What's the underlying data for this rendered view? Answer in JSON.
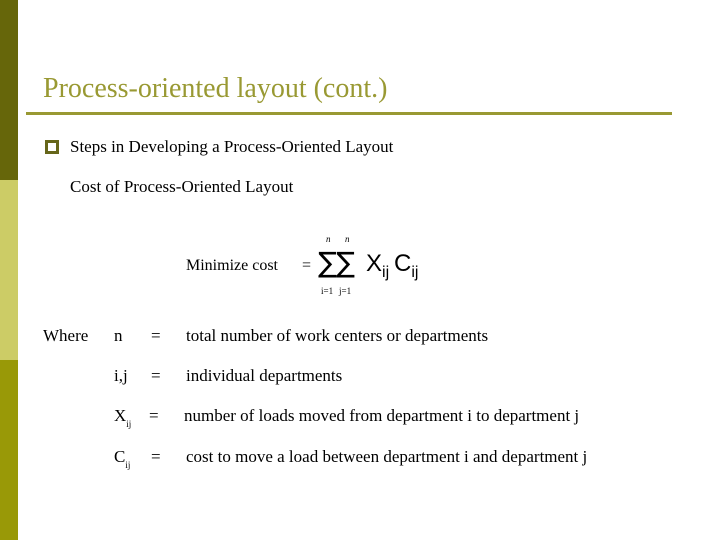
{
  "colors": {
    "sidebar_top": "#66660a",
    "sidebar_middle": "#cccc66",
    "sidebar_bottom": "#999907",
    "title": "#999933",
    "title_rule": "#999933",
    "bullet": "#66661a",
    "text": "#000000",
    "background": "#ffffff"
  },
  "slide": {
    "title": "Process-oriented layout (cont.)",
    "bullet": {
      "icon": "hollow-square-bullet",
      "text": "Steps in Developing a Process-Oriented Layout"
    },
    "subheading": "Cost of Process-Oriented Layout",
    "formula": {
      "label": "Minimize cost",
      "equals": "=",
      "sum_symbol": "∑",
      "upper_limit_1": "n",
      "upper_limit_2": "n",
      "lower_limit_1": "i=1",
      "lower_limit_2": "j=1",
      "term_1": "X",
      "term_1_sub": "ij",
      "term_2": "C",
      "term_2_sub": "ij"
    },
    "definitions": {
      "where_label": "Where",
      "rows": [
        {
          "symbol": "n",
          "subscript": "",
          "equals": "=",
          "text": "total number of work centers or departments"
        },
        {
          "symbol": "i,j",
          "subscript": "",
          "equals": "=",
          "text": "individual departments"
        },
        {
          "symbol": "X",
          "subscript": "ij",
          "equals": "=",
          "text": "number of loads moved from department i to department j"
        },
        {
          "symbol": "C",
          "subscript": "ij",
          "equals": "=",
          "text": "cost to move a load between department i and department j"
        }
      ]
    }
  }
}
